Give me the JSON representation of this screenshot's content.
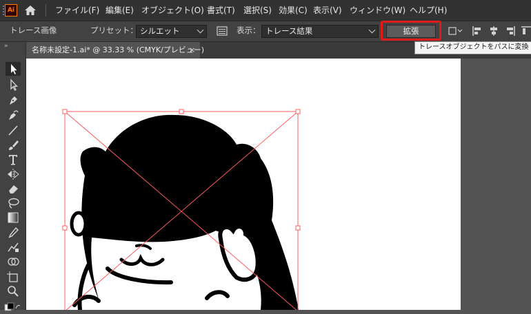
{
  "app": {
    "logo_text": "Ai"
  },
  "menu": {
    "items": [
      {
        "label": "ファイル(F)"
      },
      {
        "label": "編集(E)"
      },
      {
        "label": "オブジェクト(O)"
      },
      {
        "label": "書式(T)"
      },
      {
        "label": "選択(S)"
      },
      {
        "label": "効果(C)"
      },
      {
        "label": "表示(V)"
      },
      {
        "label": "ウィンドウ(W)"
      },
      {
        "label": "ヘルプ(H)"
      }
    ]
  },
  "controlbar": {
    "panel_label": "トレース画像",
    "preset_label": "プリセット：",
    "preset_value": "シルエット",
    "view_label": "表示：",
    "view_value": "トレース結果",
    "expand_button": "拡張",
    "tooltip": "トレースオブジェクトをパスに変換"
  },
  "document": {
    "tab_title": "名称未設定-1.ai* @ 33.33 % (CMYK/プレビュー)",
    "close_glyph": "×"
  },
  "toolbar": {
    "collapse_glyph": "»",
    "tools": [
      "selection-tool",
      "direct-selection-tool",
      "pen-tool",
      "curvature-tool",
      "line-segment-tool",
      "paintbrush-tool",
      "type-tool",
      "reflect-tool",
      "eraser-tool",
      "lasso-tool",
      "gradient-tool",
      "eyedropper-tool",
      "blend-tool",
      "shape-builder-tool",
      "artboard-tool",
      "zoom-tool"
    ]
  },
  "colors": {
    "highlight": "#e21a1a",
    "selection": "#ff5b5b",
    "app_logo": "#ff7c00"
  }
}
